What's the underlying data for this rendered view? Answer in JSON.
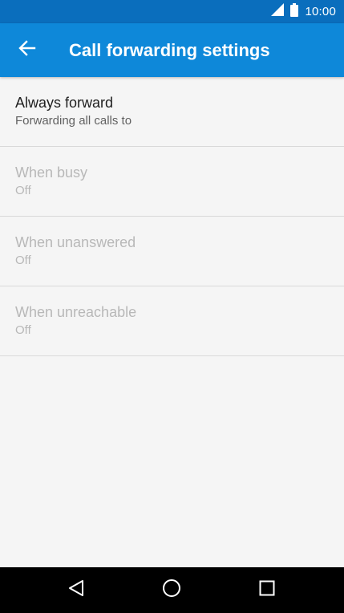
{
  "status_bar": {
    "time": "10:00",
    "icons": [
      "cellular-signal-icon",
      "battery-icon"
    ]
  },
  "app_bar": {
    "back_icon": "arrow-back-icon",
    "title": "Call forwarding settings"
  },
  "list": {
    "items": [
      {
        "title": "Always forward",
        "subtitle": "Forwarding all calls to",
        "enabled": true
      },
      {
        "title": "When busy",
        "subtitle": "Off",
        "enabled": false
      },
      {
        "title": "When unanswered",
        "subtitle": "Off",
        "enabled": false
      },
      {
        "title": "When unreachable",
        "subtitle": "Off",
        "enabled": false
      }
    ]
  },
  "nav_bar": {
    "icons": [
      "nav-back-icon",
      "nav-home-icon",
      "nav-recents-icon"
    ]
  },
  "colors": {
    "status_bar": "#0a6ebd",
    "app_bar": "#0e88d9",
    "background": "#f5f5f5",
    "primary_text": "#212121",
    "secondary_text": "#616161",
    "disabled_text": "#b8b8b8",
    "nav_bar": "#000000"
  }
}
